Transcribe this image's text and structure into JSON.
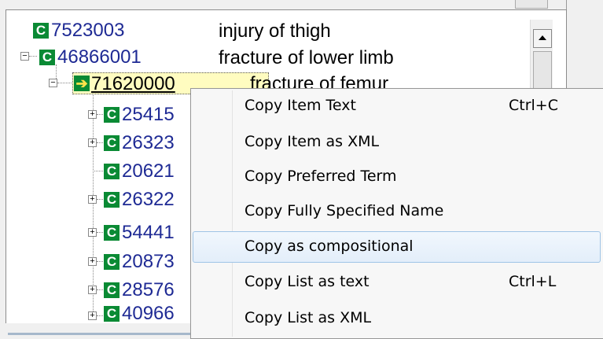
{
  "tree": {
    "rows": [
      {
        "code": "7523003",
        "label": "injury of thigh"
      },
      {
        "code": "46866001",
        "label": "fracture of lower limb"
      },
      {
        "code": "71620000",
        "label": "fracture of femur"
      },
      {
        "code": "25415"
      },
      {
        "code": "26323"
      },
      {
        "code": "20621"
      },
      {
        "code": "26322"
      },
      {
        "code": "54441"
      },
      {
        "code": "20873"
      },
      {
        "code": "28576"
      },
      {
        "code": "40966"
      }
    ],
    "icon_letter": "C",
    "expand_minus": "−",
    "expand_plus": "+",
    "selected_arrow": "➔"
  },
  "context_menu": {
    "items": [
      {
        "label": "Copy Item Text",
        "shortcut": "Ctrl+C"
      },
      {
        "label": "Copy Item as XML",
        "shortcut": ""
      },
      {
        "label": "Copy Preferred Term",
        "shortcut": ""
      },
      {
        "label": "Copy Fully Specified Name",
        "shortcut": ""
      },
      {
        "label": "Copy as compositional",
        "shortcut": ""
      },
      {
        "label": "Copy List as text",
        "shortcut": "Ctrl+L"
      },
      {
        "label": "Copy List as XML",
        "shortcut": ""
      }
    ]
  },
  "colors": {
    "concept_icon": "#0a8a34",
    "code_text": "#1e2a94",
    "selected_bg": "#fffcc0",
    "menu_hover": "#e3eefa"
  }
}
